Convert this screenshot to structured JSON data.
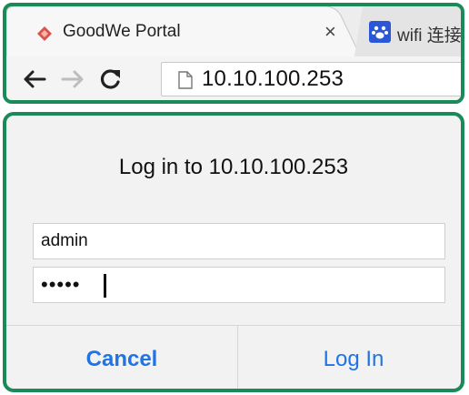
{
  "browser": {
    "active_tab": {
      "title": "GoodWe Portal",
      "close_glyph": "×",
      "icon": "diamond-favicon-icon"
    },
    "inactive_tab": {
      "title": "wifi 连接",
      "icon": "paw-favicon-icon"
    },
    "toolbar": {
      "url": "10.10.100.253"
    }
  },
  "dialog": {
    "title": "Log in to 10.10.100.253",
    "username_value": "admin",
    "password_masked": "•••••",
    "cancel_label": "Cancel",
    "login_label": "Log In"
  },
  "colors": {
    "frame_border": "#1a8a5a",
    "link_blue": "#1f74e6",
    "favicon_red": "#d9534f"
  }
}
